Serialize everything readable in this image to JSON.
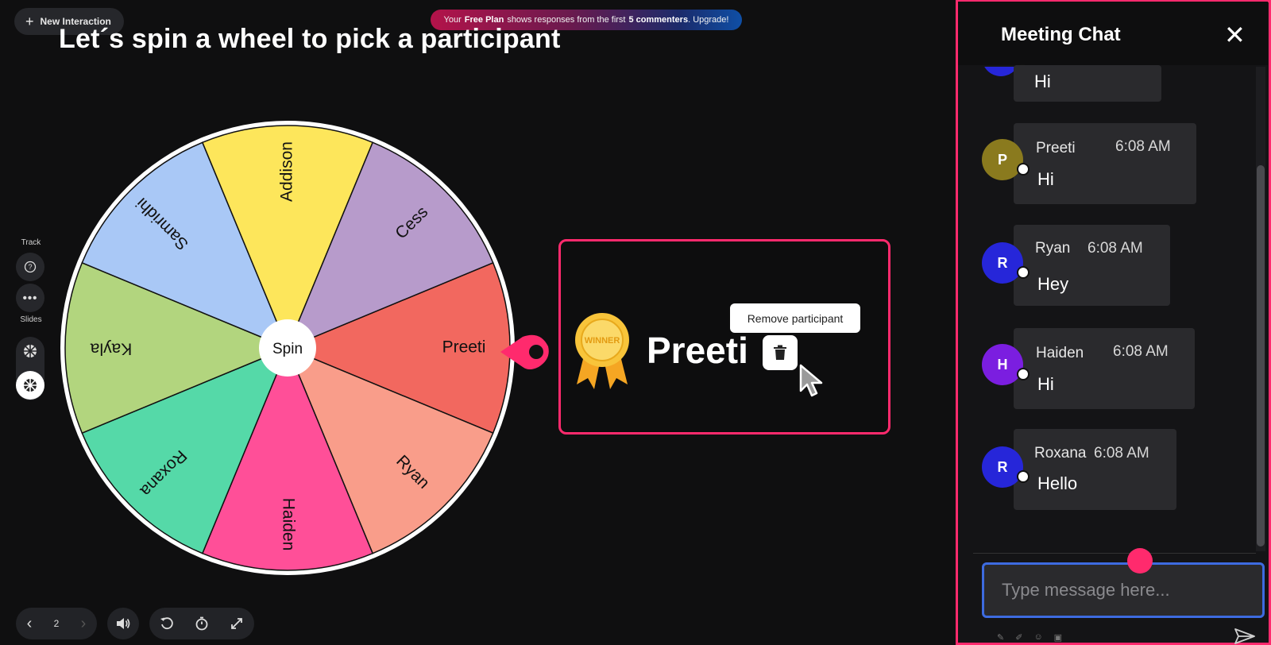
{
  "toolbar": {
    "new_interaction_label": "New Interaction"
  },
  "banner": {
    "prefix": "Your",
    "plan": "Free Plan",
    "middle": "shows responses from the first",
    "count": "5 commenters",
    "suffix": ". Upgrade!"
  },
  "slide": {
    "title": "Let´s spin a wheel to pick a participant"
  },
  "sidebar": {
    "track_label": "Track",
    "slides_label": "Slides"
  },
  "wheel": {
    "center_label": "Spin",
    "segments": [
      {
        "name": "Preeti",
        "color": "#f2685f"
      },
      {
        "name": "Ryan",
        "color": "#f99d8a"
      },
      {
        "name": "Haiden",
        "color": "#ff4f98"
      },
      {
        "name": "Roxana",
        "color": "#55d9a8"
      },
      {
        "name": "Kayla",
        "color": "#b2d57e"
      },
      {
        "name": "Samridhi",
        "color": "#a9c8f6"
      },
      {
        "name": "Addison",
        "color": "#fde65b"
      },
      {
        "name": "Cess",
        "color": "#b79bcb"
      }
    ]
  },
  "winner": {
    "badge_text": "WINNER",
    "name": "Preeti",
    "tooltip": "Remove participant"
  },
  "pager": {
    "page": "2"
  },
  "chat": {
    "title": "Meeting Chat",
    "partial_message": "Hi",
    "messages": [
      {
        "initial": "P",
        "name": "Preeti",
        "time": "6:08 AM",
        "text": "Hi",
        "color": "#8a7a1e"
      },
      {
        "initial": "R",
        "name": "Ryan",
        "time": "6:08 AM",
        "text": "Hey",
        "color": "#2626d9"
      },
      {
        "initial": "H",
        "name": "Haiden",
        "time": "6:08 AM",
        "text": "Hi",
        "color": "#7b1ee0"
      },
      {
        "initial": "R",
        "name": "Roxana",
        "time": "6:08 AM",
        "text": "Hello",
        "color": "#2626d9"
      }
    ],
    "placeholder": "Type message here..."
  },
  "colors": {
    "accent": "#ff2a6d",
    "input_border": "#3d6be0"
  }
}
